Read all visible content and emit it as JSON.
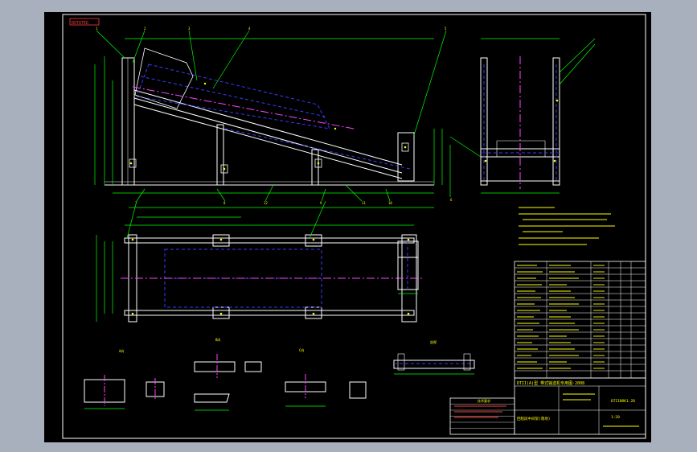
{
  "stamp": "ROTATED",
  "title_block": {
    "main_title": "DTII(A)型  带式输送机专用图·2008",
    "drawing_no": "DTII0RK1.2B",
    "scale": "1:20",
    "drawing_name": "回程段中间架(落地)"
  },
  "notes_heading": "技术要求",
  "views": {
    "view_a": "A向",
    "view_b": "B向",
    "view_c": "C向",
    "section": "剖视"
  },
  "part_labels": [
    "1",
    "2",
    "3",
    "4",
    "5",
    "6",
    "7",
    "8",
    "9",
    "10",
    "11",
    "12"
  ],
  "colors": {
    "background": "#000000",
    "frame": "#ffffff",
    "structure": "#ffffff",
    "dimension": "#00ff00",
    "hidden": "#3a3aff",
    "centerline": "#ff44ff",
    "text": "#ffff00",
    "accent": "#ff3b3b"
  }
}
